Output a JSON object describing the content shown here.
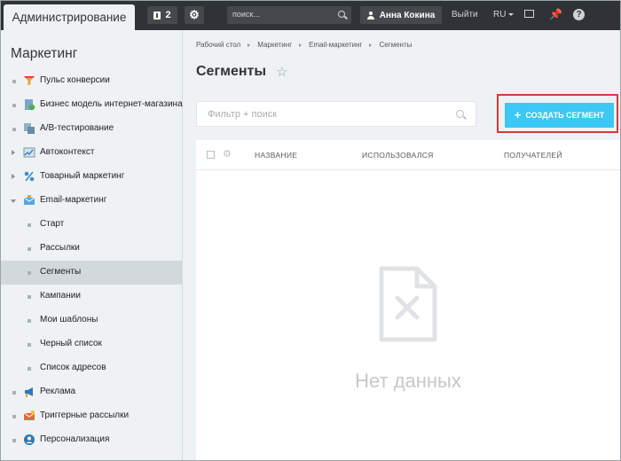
{
  "topbar": {
    "admin_tab": "Администрирование",
    "notifications_count": "2",
    "search_placeholder": "поиск...",
    "user_name": "Анна Кокина",
    "exit_label": "Выйти",
    "language": "RU"
  },
  "sidebar": {
    "title": "Маркетинг",
    "items": [
      {
        "label": "Пульс конверсии",
        "icon": "funnel-icon"
      },
      {
        "label": "Бизнес модель интернет-магазина",
        "icon": "business-model-icon"
      },
      {
        "label": "A/B-тестирование",
        "icon": "ab-test-icon"
      },
      {
        "label": "Автоконтекст",
        "icon": "chart-icon"
      },
      {
        "label": "Товарный маркетинг",
        "icon": "percent-icon"
      },
      {
        "label": "Email-маркетинг",
        "icon": "email-icon"
      }
    ],
    "email_sub": [
      {
        "label": "Старт"
      },
      {
        "label": "Рассылки"
      },
      {
        "label": "Сегменты"
      },
      {
        "label": "Кампании"
      },
      {
        "label": "Мои шаблоны"
      },
      {
        "label": "Черный список"
      },
      {
        "label": "Список адресов"
      }
    ],
    "bottom_items": [
      {
        "label": "Реклама",
        "icon": "megaphone-icon"
      },
      {
        "label": "Триггерные рассылки",
        "icon": "trigger-mail-icon"
      },
      {
        "label": "Персонализация",
        "icon": "person-icon"
      }
    ]
  },
  "main": {
    "breadcrumbs": [
      "Рабочий стол",
      "Маркетинг",
      "Email-маркетинг",
      "Сегменты"
    ],
    "title": "Сегменты",
    "filter_placeholder": "Фильтр + поиск",
    "create_button": "СОЗДАТЬ СЕГМЕНТ",
    "columns": [
      "НАЗВАНИЕ",
      "ИСПОЛЬЗОВАЛСЯ",
      "ПОЛУЧАТЕЛЕЙ"
    ],
    "empty_text": "Нет данных"
  },
  "colors": {
    "topbar": "#2f3337",
    "accent_button": "#3bc8f5",
    "highlight_border": "#d9383a"
  }
}
